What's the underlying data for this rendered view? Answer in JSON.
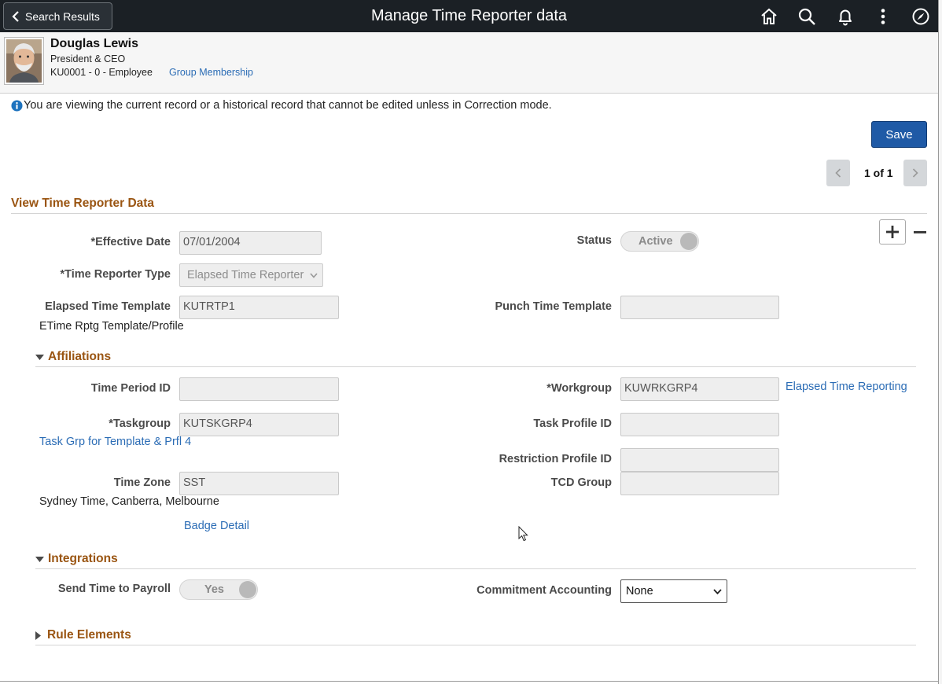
{
  "header": {
    "back_label": "Search Results",
    "title": "Manage Time Reporter data",
    "icons": [
      "home-icon",
      "search-icon",
      "bell-icon",
      "kebab-menu-icon",
      "navbar-compass-icon"
    ]
  },
  "employee": {
    "name": "Douglas Lewis",
    "job_title": "President & CEO",
    "id_line": "KU0001 - 0 - Employee",
    "group_link": "Group Membership"
  },
  "notice": "You are viewing the current record or a historical record that cannot be edited unless in Correction mode.",
  "toolbar": {
    "save_label": "Save",
    "pager_text": "1 of 1"
  },
  "section": {
    "title": "View Time Reporter Data"
  },
  "fields": {
    "effective_date": {
      "label": "*Effective Date",
      "value": "07/01/2004"
    },
    "status": {
      "label": "Status",
      "value": "Active"
    },
    "time_reporter_type": {
      "label": "*Time Reporter Type",
      "value": "Elapsed Time Reporter"
    },
    "elapsed_template": {
      "label": "Elapsed Time Template",
      "value": "KUTRTP1",
      "description": "ETime Rptg Template/Profile"
    },
    "punch_template": {
      "label": "Punch Time Template",
      "value": ""
    }
  },
  "affiliations": {
    "title": "Affiliations",
    "time_period_id": {
      "label": "Time Period ID",
      "value": ""
    },
    "workgroup": {
      "label": "*Workgroup",
      "value": "KUWRKGRP4",
      "link": "Elapsed Time Reporting"
    },
    "taskgroup": {
      "label": "*Taskgroup",
      "value": "KUTSKGRP4",
      "link": "Task Grp for Template & Prfl 4"
    },
    "task_profile_id": {
      "label": "Task Profile ID",
      "value": ""
    },
    "restriction_profile_id": {
      "label": "Restriction Profile ID",
      "value": ""
    },
    "time_zone": {
      "label": "Time Zone",
      "value": "SST",
      "description": "Sydney Time, Canberra, Melbourne"
    },
    "tcd_group": {
      "label": "TCD Group",
      "value": ""
    },
    "badge_link": "Badge Detail"
  },
  "integrations": {
    "title": "Integrations",
    "send_time": {
      "label": "Send Time to Payroll",
      "value": "Yes"
    },
    "commitment": {
      "label": "Commitment Accounting",
      "value": "None"
    }
  },
  "rule_elements": {
    "title": "Rule Elements"
  },
  "colors": {
    "banner": "#1b2025",
    "accent_brown": "#9a5512",
    "link_blue": "#2b6cb5",
    "save_blue": "#1f5aa6"
  }
}
